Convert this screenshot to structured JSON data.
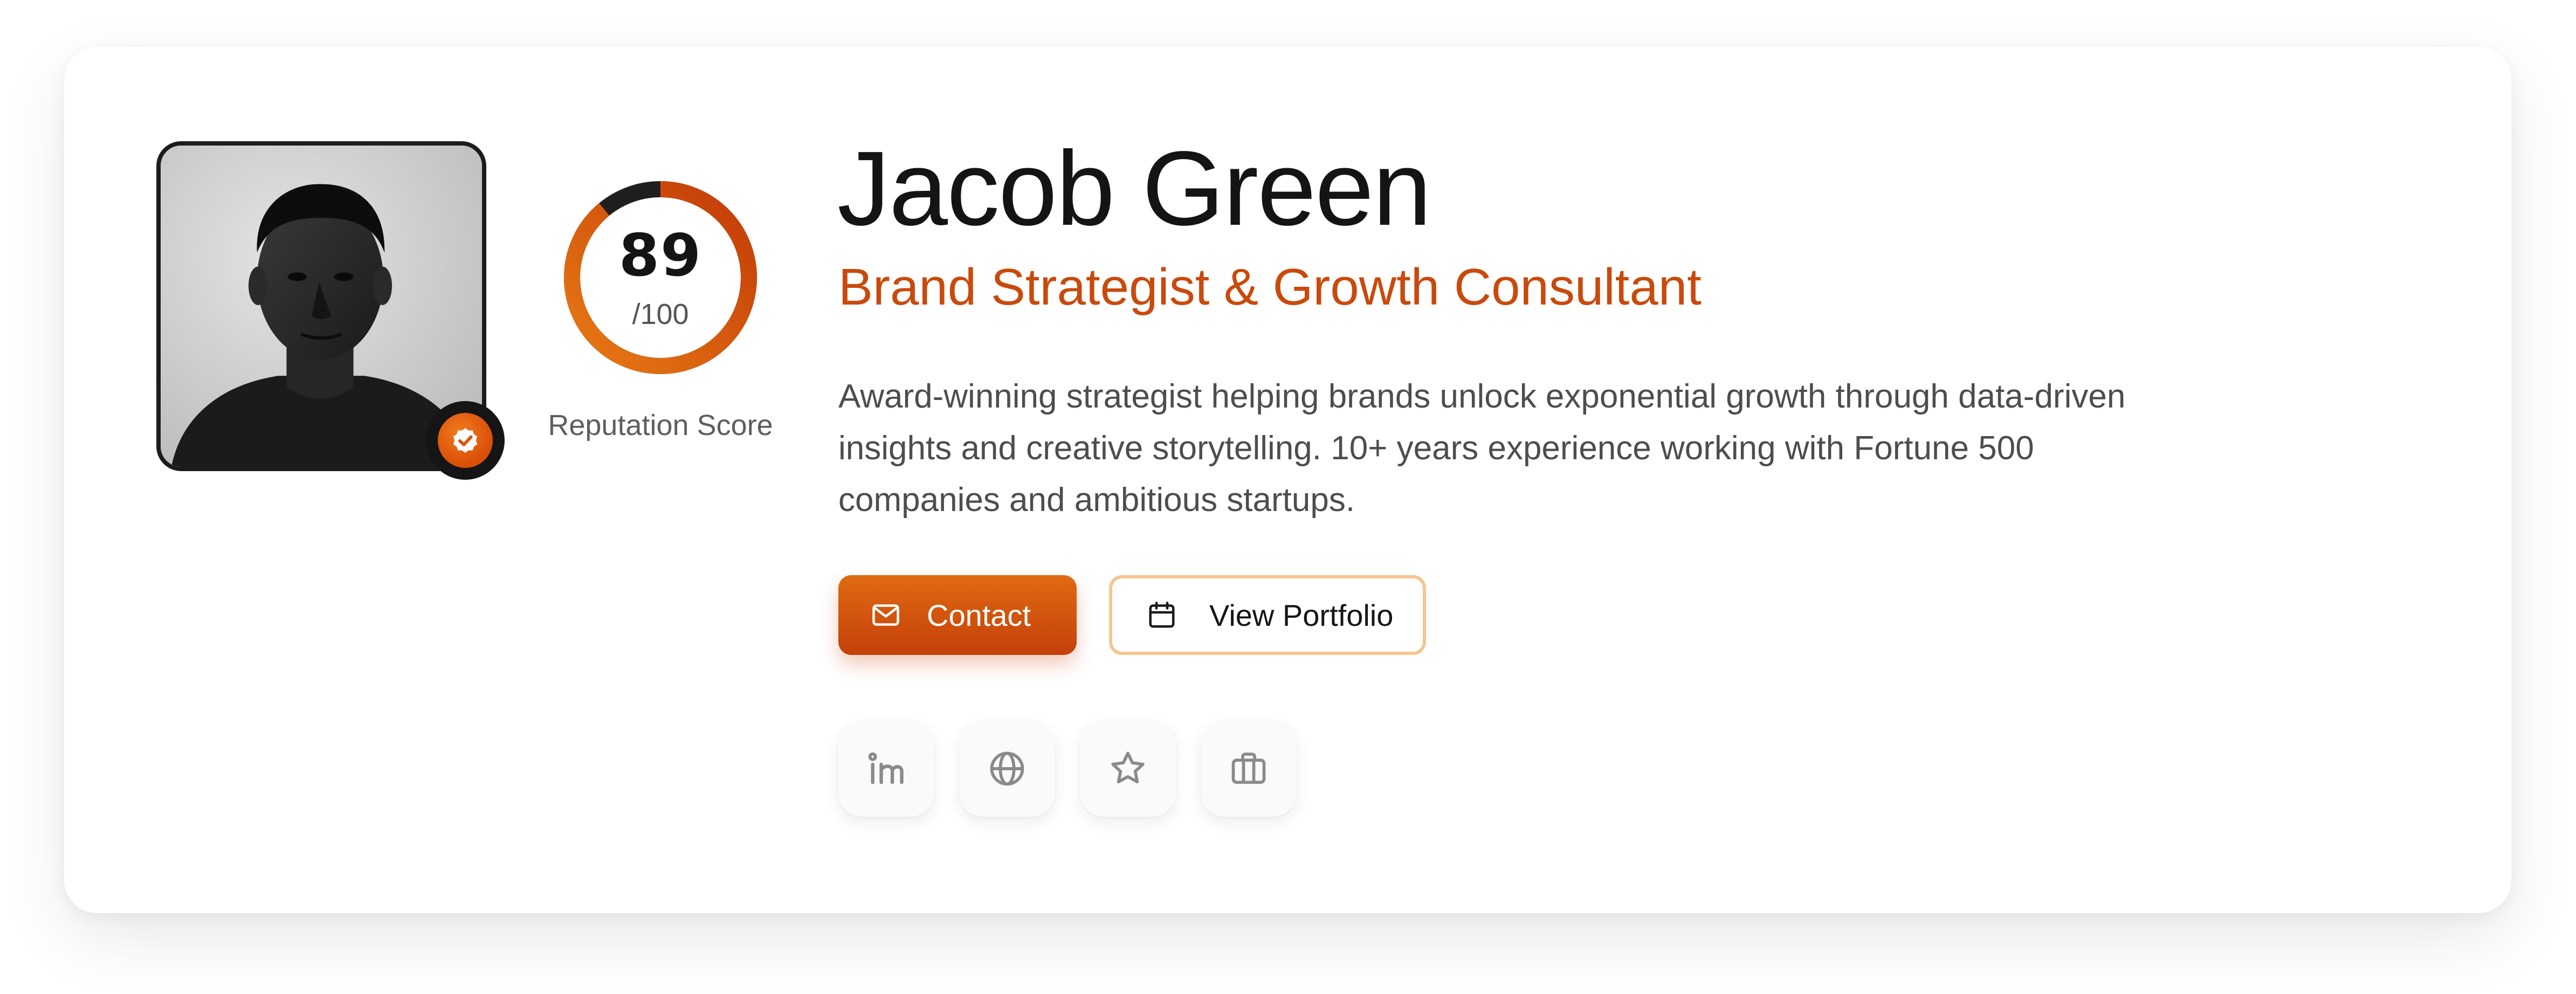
{
  "profile": {
    "name": "Jacob Green",
    "role": "Brand Strategist & Growth Consultant",
    "bio": "Award-winning strategist helping brands unlock exponential growth through data-driven insights and creative storytelling. 10+ years experience working with Fortune 500 companies and ambitious startups.",
    "avatar_icon": "portrait-photo",
    "verified_icon": "verified-check-icon"
  },
  "reputation": {
    "score": "89",
    "max": "/100",
    "fraction": 0.89,
    "label": "Reputation Score"
  },
  "actions": {
    "contact_label": "Contact",
    "contact_icon": "mail-icon",
    "portfolio_label": "View Portfolio",
    "portfolio_icon": "calendar-icon"
  },
  "social_links": [
    {
      "icon": "linkedin-icon"
    },
    {
      "icon": "globe-icon"
    },
    {
      "icon": "star-icon"
    },
    {
      "icon": "briefcase-icon"
    }
  ],
  "colors": {
    "accent": "#D9540E",
    "accent_dark": "#C4400A",
    "outline": "#F4C690",
    "text": "#141414",
    "muted": "#5E5E5E"
  }
}
